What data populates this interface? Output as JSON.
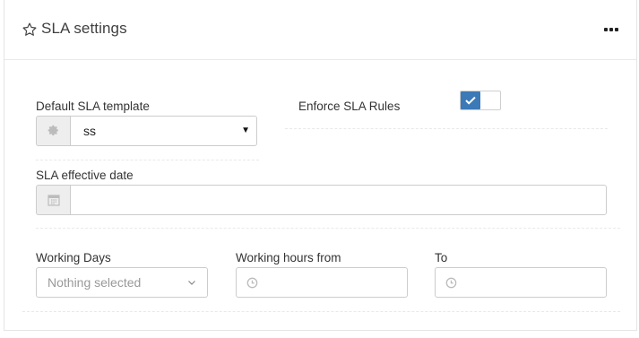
{
  "panel": {
    "title": "SLA settings",
    "star_icon": "star-outline-icon",
    "menu_icon": "more-horizontal-icon"
  },
  "form": {
    "default_sla_template": {
      "label": "Default SLA template",
      "value": "ss",
      "icon": "gear-icon"
    },
    "enforce_sla_rules": {
      "label": "Enforce SLA Rules",
      "checked": true,
      "accent": "#3b79b7"
    },
    "sla_effective_date": {
      "label": "SLA effective date",
      "value": "",
      "icon": "calendar-icon"
    },
    "working_days": {
      "label": "Working Days",
      "placeholder": "Nothing selected"
    },
    "working_hours_from": {
      "label": "Working hours from",
      "value": "",
      "icon": "clock-icon"
    },
    "working_hours_to": {
      "label": "To",
      "value": "",
      "icon": "clock-icon"
    }
  }
}
